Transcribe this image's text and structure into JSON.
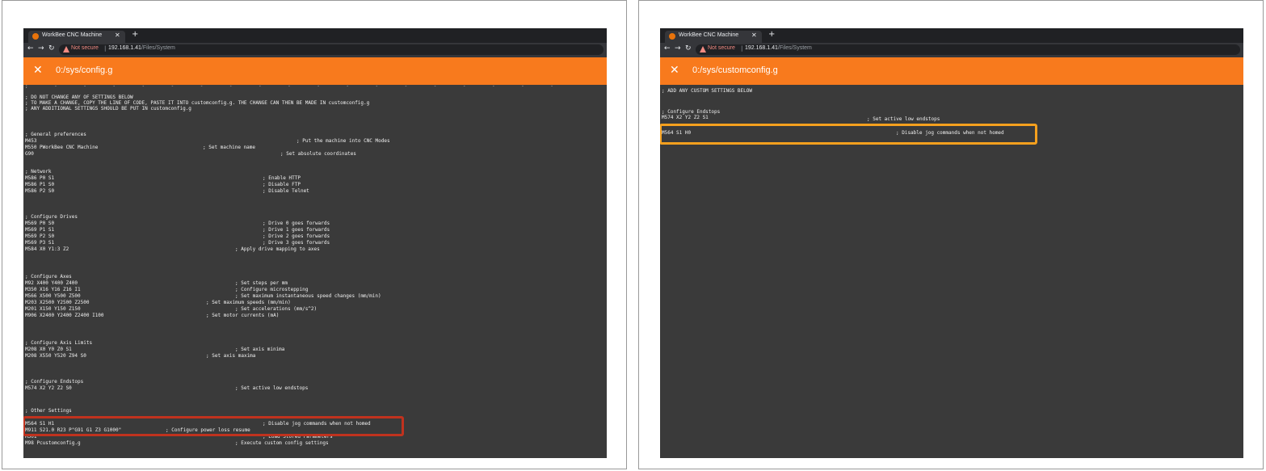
{
  "colors": {
    "toolbar": "#f87a1d",
    "editor_bg": "#3a3a3a",
    "highlight_left": "#c0321e",
    "highlight_right": "#f5a01e"
  },
  "left": {
    "tab_title": "WorkBee CNC Machine",
    "security": "Not secure",
    "url_host": "192.168.1.41",
    "url_path": "/Files/System",
    "file_title": "0:/sys/config.g",
    "lines": [
      "; DO NOT CHANGE ANY OF SETTINGS BELOW",
      "; TO MAKE A CHANGE, COPY THE LINE OF CODE, PASTE IT INTO customconfig.g. THE CHANGE CAN THEN BE MADE IN customconfig.g",
      "; ANY ADDITIONAL SETTINGS SHOULD BE PUT IN customconfig.g",
      "; General preferences",
      "M453",
      "M550 PWorkBee CNC Machine",
      "G90",
      "; Network",
      "M586 P0 S1",
      "M586 P1 S0",
      "M586 P2 S0",
      "; Configure Drives",
      "M569 P0 S0",
      "M569 P1 S1",
      "M569 P2 S0",
      "M569 P3 S1",
      "M584 X0 Y1:3 Z2",
      "; Configure Axes",
      "M92 X400 Y400 Z400",
      "M350 X16 Y16 Z16 I1",
      "M566 X500 Y500 Z500",
      "M203 X2500 Y2500 Z2500",
      "M201 X150 Y150 Z150",
      "M906 X2400 Y2400 Z2400 I100",
      "; Configure Axis Limits",
      "M208 X0 Y0 Z0 S1",
      "M208 X550 Y520 Z94 S0",
      "; Configure Endstops",
      "M574 X2 Y2 Z2 S0",
      "; Other Settings",
      "M564 S1 H1",
      "M911 S21.0 R23 P\"G91 G1 Z3 G1000\"",
      "M501",
      "M98 Pcustomconfig.g"
    ],
    "comments": [
      "; Put the machine into CNC Modes",
      "; Set machine name",
      "; Set absolute coordinates",
      "; Enable HTTP",
      "; Disable FTP",
      "; Disable Telnet",
      "; Drive 0 goes forwards",
      "; Drive 1 goes forwards",
      "; Drive 2 goes forwards",
      "; Drive 3 goes forwards",
      "; Apply drive mapping to axes",
      "; Set steps per mm",
      "; Configure microstepping",
      "; Set maximum instantaneous speed changes (mm/min)",
      "; Set maximum speeds (mm/min)",
      "; Set accelerations (mm/s^2)",
      "; Set motor currents (mA)",
      "; Set axis minima",
      "; Set axis maxima",
      "; Set active low endstops",
      "; Disable jog commands when not homed",
      "; Configure power loss resume",
      "; Load Stored Parameters",
      "; Execute custom config settings"
    ]
  },
  "right": {
    "tab_title": "WorkBee CNC Machine",
    "security": "Not secure",
    "url_host": "192.168.1.41",
    "url_path": "/Files/System",
    "file_title": "0:/sys/customconfig.g",
    "lines": [
      "; ADD ANY CUSTOM SETTINGS BELOW",
      "; Configure Endstops",
      "M574 X2 Y2 Z2 S1",
      "M564 S1 H0"
    ],
    "comments": [
      "; Set active low endstops",
      "; Disable jog commands when not homed"
    ]
  }
}
